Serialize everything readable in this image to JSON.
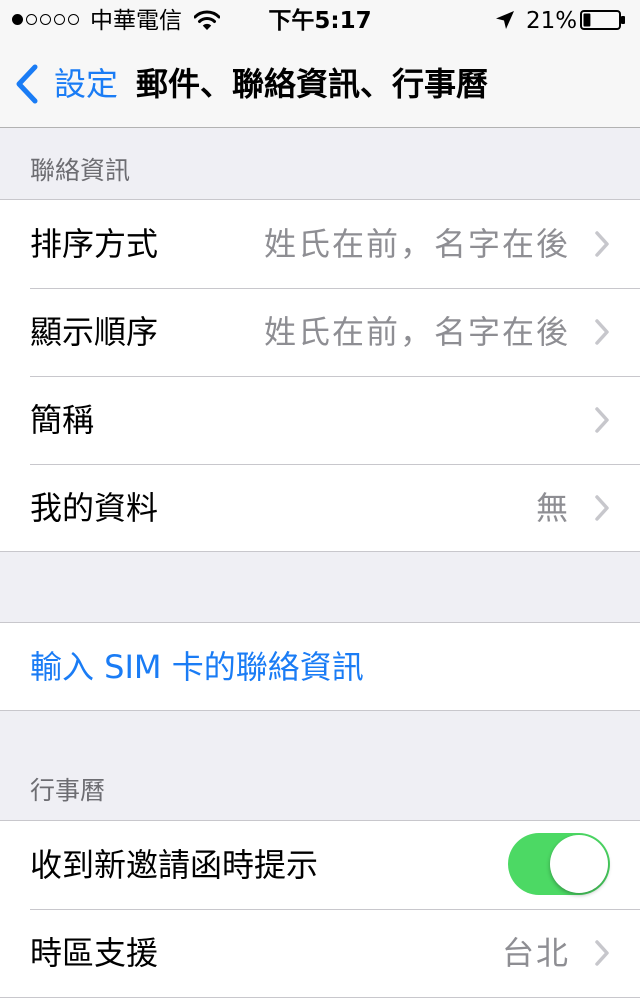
{
  "status_bar": {
    "carrier": "中華電信",
    "time": "下午5:17",
    "battery": "21%",
    "signal_bars_filled": 1,
    "signal_bars_total": 5,
    "battery_level": 0.21,
    "icons": [
      "wifi-icon",
      "location-arrow-icon",
      "battery-icon"
    ]
  },
  "nav": {
    "back_label": "設定",
    "title": "郵件、聯絡資訊、行事曆"
  },
  "contacts": {
    "header": "聯絡資訊",
    "rows": [
      {
        "label": "排序方式",
        "value": "姓氏在前，名字在後"
      },
      {
        "label": "顯示順序",
        "value": "姓氏在前，名字在後"
      },
      {
        "label": "簡稱",
        "value": ""
      },
      {
        "label": "我的資料",
        "value": "無"
      }
    ]
  },
  "sim_import": {
    "label": "輸入 SIM 卡的聯絡資訊"
  },
  "calendar": {
    "header": "行事曆",
    "invite_alert_label": "收到新邀請函時提示",
    "invite_alert_on": true,
    "timezone_label": "時區支援",
    "timezone_value": "台北"
  },
  "colors": {
    "accent": "#1a7cf5",
    "toggle_on": "#4cd964",
    "background": "#efeff4",
    "secondary_text": "#8e8e93"
  }
}
